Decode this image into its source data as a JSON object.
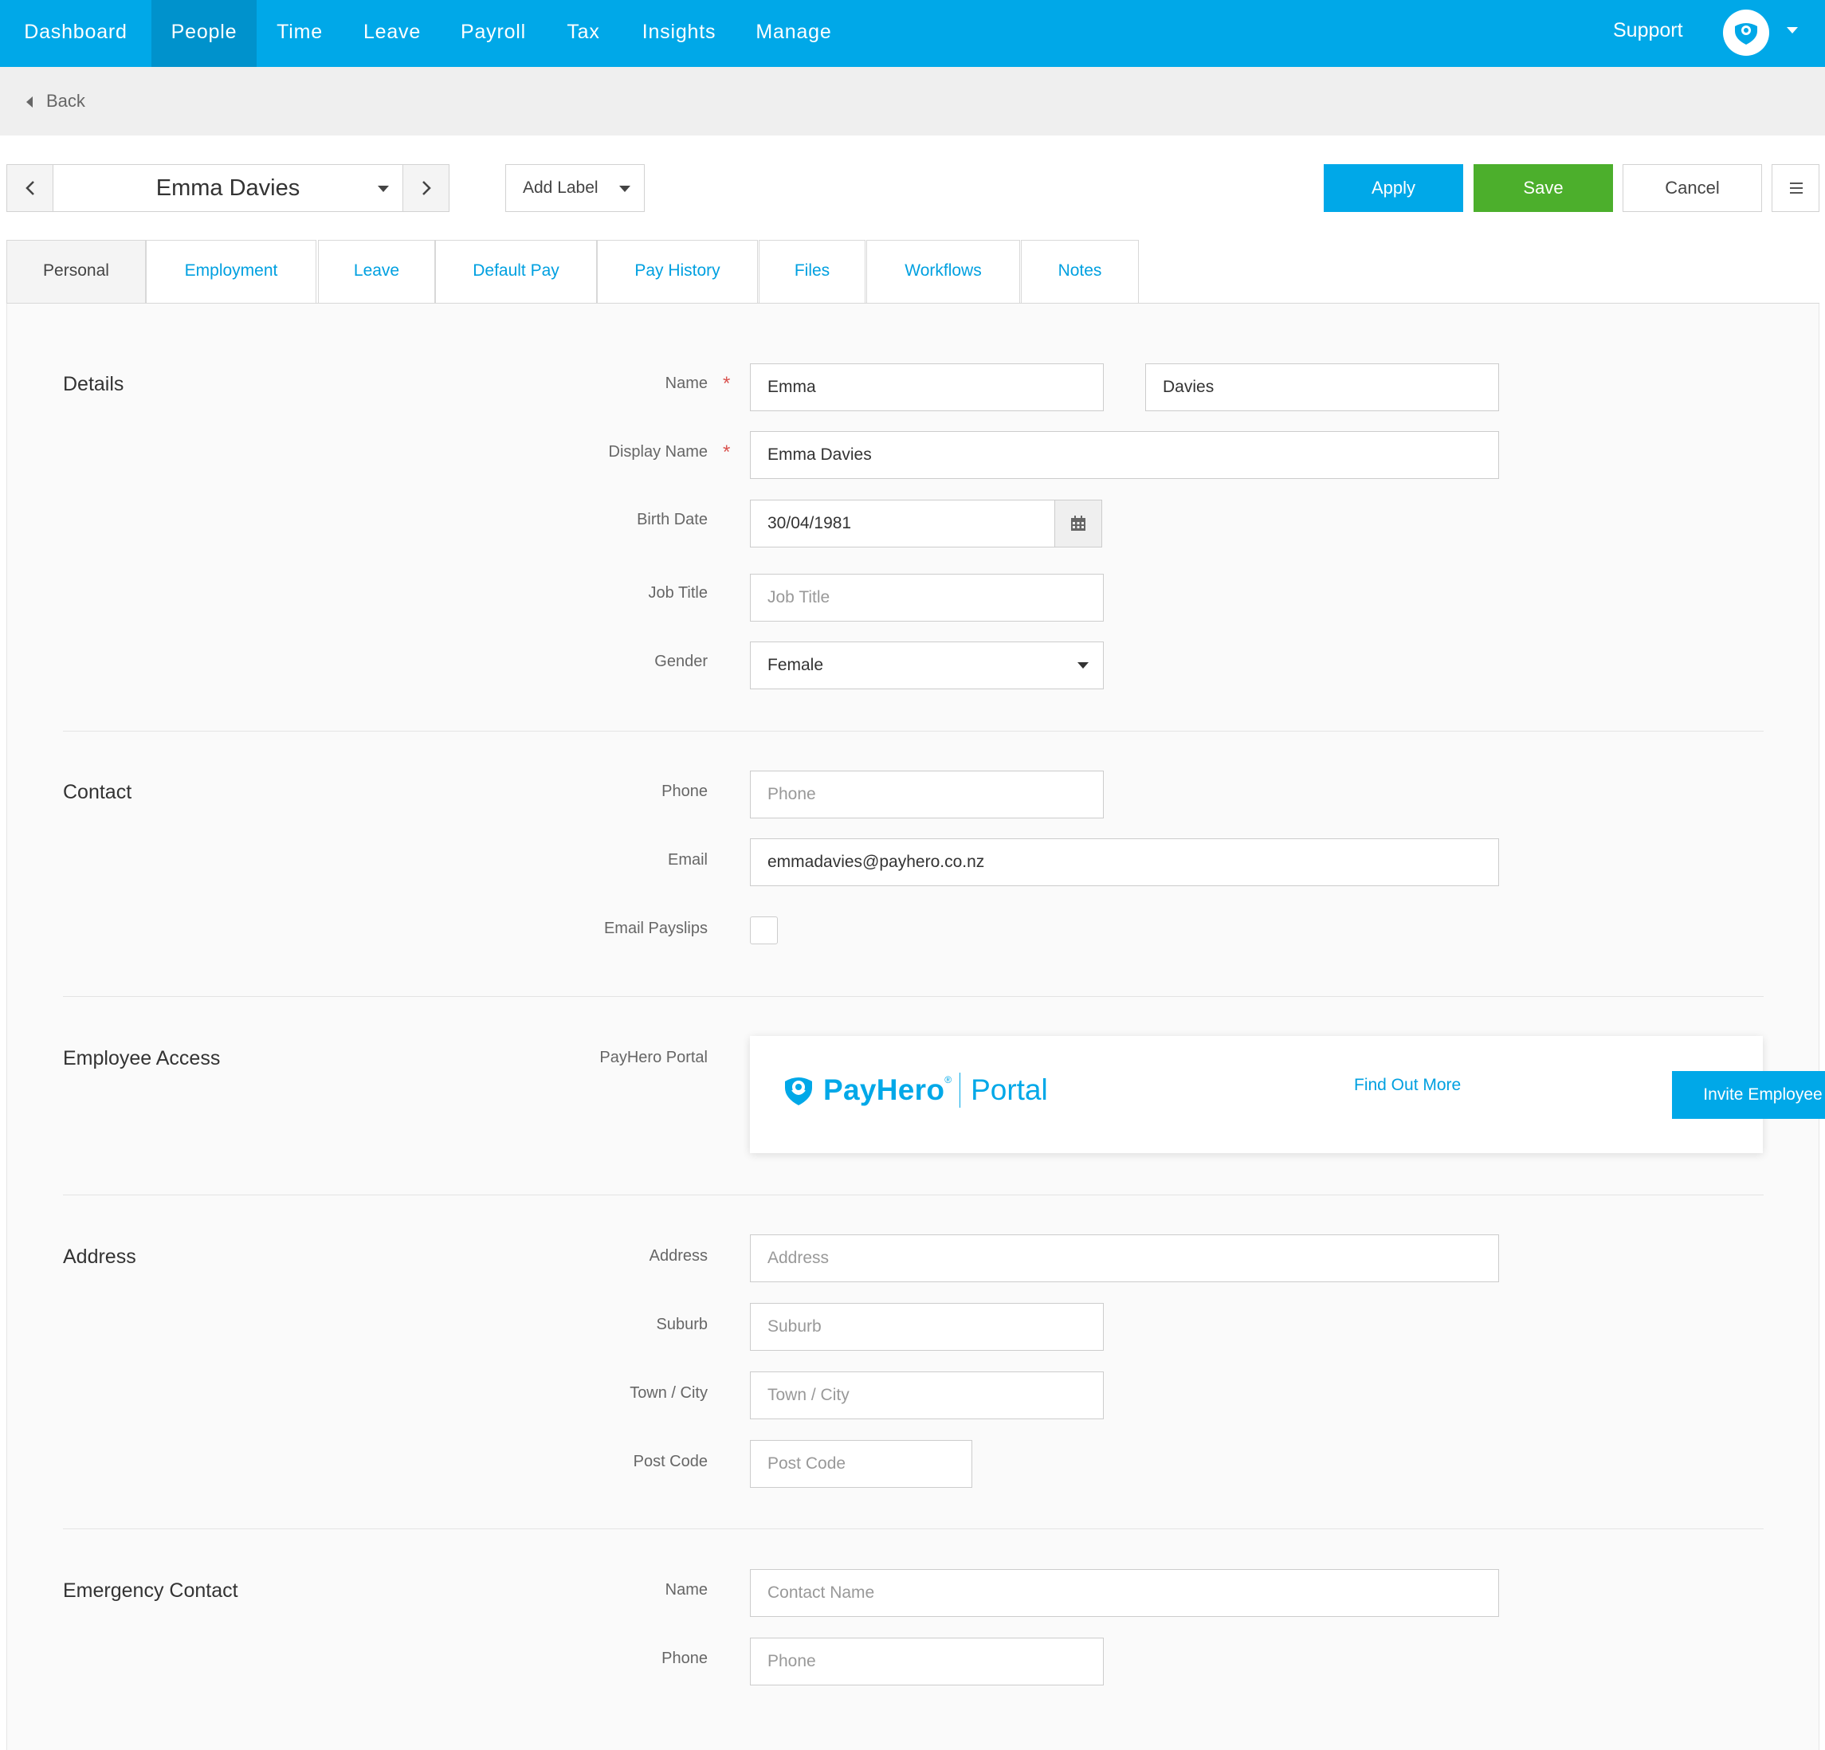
{
  "nav": {
    "items": [
      {
        "label": "Dashboard"
      },
      {
        "label": "People"
      },
      {
        "label": "Time"
      },
      {
        "label": "Leave"
      },
      {
        "label": "Payroll"
      },
      {
        "label": "Tax"
      },
      {
        "label": "Insights"
      },
      {
        "label": "Manage"
      }
    ],
    "active": "People",
    "support_label": "Support",
    "avatar_icon": "payhero-heart-icon"
  },
  "back": {
    "label": "Back"
  },
  "toolbar": {
    "employee_name": "Emma Davies",
    "add_label": "Add Label",
    "apply_label": "Apply",
    "save_label": "Save",
    "cancel_label": "Cancel",
    "menu_icon": "hamburger-icon"
  },
  "tabs": [
    {
      "label": "Personal"
    },
    {
      "label": "Employment"
    },
    {
      "label": "Leave"
    },
    {
      "label": "Default Pay"
    },
    {
      "label": "Pay History"
    },
    {
      "label": "Files"
    },
    {
      "label": "Workflows"
    },
    {
      "label": "Notes"
    }
  ],
  "active_tab": "Personal",
  "sections": {
    "details": {
      "title": "Details",
      "name_label": "Name",
      "first_name": "Emma",
      "last_name": "Davies",
      "display_name_label": "Display Name",
      "display_name": "Emma Davies",
      "birth_date_label": "Birth Date",
      "birth_date": "30/04/1981",
      "job_title_label": "Job Title",
      "job_title_placeholder": "Job Title",
      "gender_label": "Gender",
      "gender": "Female",
      "required_mark": "*"
    },
    "contact": {
      "title": "Contact",
      "phone_label": "Phone",
      "phone_placeholder": "Phone",
      "email_label": "Email",
      "email": "emmadavies@payhero.co.nz",
      "email_payslips_label": "Email Payslips",
      "email_payslips_checked": false
    },
    "access": {
      "title": "Employee Access",
      "portal_label": "PayHero Portal",
      "brand": "PayHero",
      "brand_mark": "®",
      "product": "Portal",
      "find_out_more": "Find Out More",
      "invite_button": "Invite Employee"
    },
    "address": {
      "title": "Address",
      "address_label": "Address",
      "address_placeholder": "Address",
      "suburb_label": "Suburb",
      "suburb_placeholder": "Suburb",
      "city_label": "Town / City",
      "city_placeholder": "Town / City",
      "postcode_label": "Post Code",
      "postcode_placeholder": "Post Code"
    },
    "emergency": {
      "title": "Emergency Contact",
      "name_label": "Name",
      "name_placeholder": "Contact Name",
      "phone_label": "Phone",
      "phone_placeholder": "Phone"
    }
  },
  "colors": {
    "primary": "#00a8e8",
    "nav_active": "#0092cc",
    "save": "#4caf2c",
    "required": "#d9534f"
  }
}
